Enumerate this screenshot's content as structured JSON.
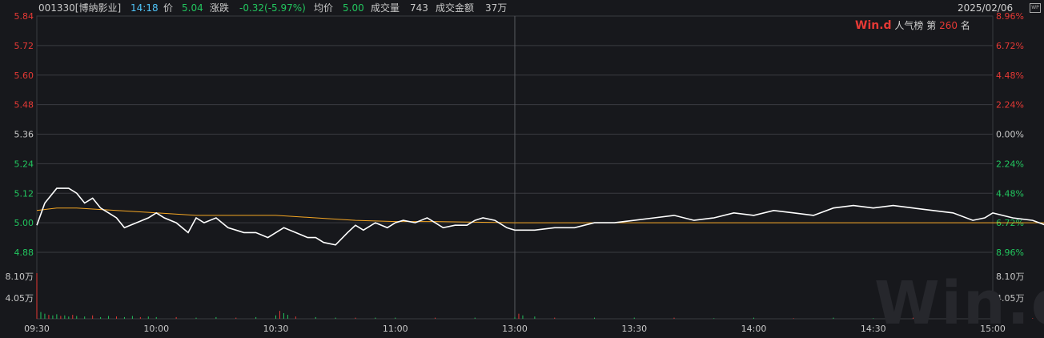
{
  "header": {
    "code": "001330[博纳影业]",
    "time": "14:18",
    "price_label": "价",
    "price": "5.04",
    "change_label": "涨跌",
    "change": "-0.32(-5.97%)",
    "avg_label": "均价",
    "avg": "5.00",
    "volume_label": "成交量",
    "volume": "743",
    "amount_label": "成交金额",
    "amount": "37万",
    "date": "2025/02/06",
    "wp_icon": "wp-icon"
  },
  "badge": {
    "logo": "Win.d",
    "text": "人气榜",
    "rank_prefix": "第",
    "rank": "260",
    "rank_suffix": "名"
  },
  "watermark": "Win.d",
  "colors": {
    "up": "#e53935",
    "down": "#22c55e",
    "price_line": "#ffffff",
    "avg_line": "#f5a623",
    "grid": "#3a3b40"
  },
  "chart_data": {
    "type": "line",
    "x_ticks": [
      "09:30",
      "10:00",
      "10:30",
      "11:00",
      "13:00",
      "13:30",
      "14:00",
      "14:30",
      "15:00"
    ],
    "y_ticks_price": [
      "5.84",
      "5.72",
      "5.60",
      "5.48",
      "5.36",
      "5.24",
      "5.12",
      "5.00",
      "4.88"
    ],
    "y_ticks_pct": [
      "8.96%",
      "6.72%",
      "4.48%",
      "2.24%",
      "0.00%",
      "2.24%",
      "4.48%",
      "6.72%",
      "8.96%"
    ],
    "ylim": [
      4.88,
      5.84
    ],
    "prev_close": 5.36,
    "volume_ticks": [
      "8.10万",
      "4.05万"
    ],
    "volume_max": 8.1,
    "series": [
      {
        "name": "price",
        "x": [
          0,
          2,
          5,
          8,
          10,
          12,
          14,
          16,
          18,
          20,
          22,
          25,
          28,
          30,
          32,
          35,
          38,
          40,
          42,
          45,
          48,
          50,
          52,
          55,
          58,
          60,
          62,
          65,
          68,
          70,
          72,
          75,
          78,
          80,
          82,
          85,
          88,
          90,
          92,
          95,
          98,
          100,
          102,
          105,
          108,
          110,
          112,
          115,
          118,
          120,
          125,
          130,
          135,
          140,
          145,
          150,
          155,
          160,
          165,
          170,
          175,
          180,
          185,
          190,
          195,
          200,
          205,
          210,
          215,
          220,
          225,
          230,
          235,
          238,
          240,
          245,
          250,
          255,
          260,
          265,
          270,
          275,
          280,
          285,
          290,
          295,
          300,
          305,
          310,
          315,
          320,
          325,
          330,
          335,
          340,
          345,
          350,
          355,
          360,
          365,
          370,
          375,
          380,
          385,
          390,
          395,
          400,
          405,
          410,
          415,
          420,
          425,
          430,
          435,
          440,
          445,
          450,
          455,
          460,
          465,
          470,
          475,
          480
        ],
        "y": [
          4.99,
          5.08,
          5.14,
          5.14,
          5.12,
          5.08,
          5.1,
          5.06,
          5.04,
          5.02,
          4.98,
          5.0,
          5.02,
          5.04,
          5.02,
          5.0,
          4.96,
          5.02,
          5.0,
          5.02,
          4.98,
          4.97,
          4.96,
          4.96,
          4.94,
          4.96,
          4.98,
          4.96,
          4.94,
          4.94,
          4.92,
          4.91,
          4.96,
          4.99,
          4.97,
          5.0,
          4.98,
          5.0,
          5.01,
          5.0,
          5.02,
          5.0,
          4.98,
          4.99,
          4.99,
          5.01,
          5.02,
          5.01,
          4.98,
          4.97,
          4.97,
          4.98,
          4.98,
          5.0,
          5.0,
          5.01,
          5.02,
          5.03,
          5.01,
          5.02,
          5.04,
          5.03,
          5.05,
          5.04,
          5.03,
          5.06,
          5.07,
          5.06,
          5.07,
          5.06,
          5.05,
          5.04,
          5.01,
          5.02,
          5.04,
          5.02,
          5.01,
          4.98,
          4.98,
          4.98,
          4.99,
          4.99,
          5.0,
          5.01,
          5.01,
          4.99,
          4.99,
          4.99,
          4.99,
          4.99,
          4.98,
          4.98,
          4.99,
          5.0,
          4.99,
          4.99,
          4.98,
          4.99,
          5.0,
          5.0,
          5.0,
          5.0,
          4.99,
          5.0,
          5.01,
          5.01,
          5.01,
          5.02,
          5.02,
          5.02,
          5.03,
          5.04,
          5.04,
          5.04,
          5.05,
          5.04,
          5.05,
          5.05,
          5.06,
          5.07,
          5.07,
          5.07,
          5.08
        ]
      },
      {
        "name": "avg",
        "x": [
          0,
          5,
          10,
          20,
          30,
          40,
          50,
          60,
          70,
          80,
          90,
          100,
          120,
          150,
          180,
          200,
          240,
          300,
          360,
          420,
          480
        ],
        "y": [
          5.05,
          5.06,
          5.06,
          5.05,
          5.04,
          5.03,
          5.03,
          5.03,
          5.02,
          5.01,
          5.005,
          5.005,
          5.0,
          5.0,
          5.0,
          5.0,
          5.0,
          5.0,
          5.0,
          5.0,
          5.0
        ]
      },
      {
        "name": "volume",
        "x": [
          0,
          1,
          2,
          3,
          4,
          5,
          6,
          7,
          8,
          9,
          10,
          12,
          14,
          16,
          18,
          20,
          22,
          24,
          26,
          28,
          30,
          35,
          40,
          45,
          50,
          55,
          60,
          61,
          62,
          63,
          65,
          70,
          75,
          80,
          85,
          90,
          100,
          110,
          120,
          121,
          122,
          125,
          130,
          140,
          150,
          160,
          170,
          180,
          190,
          200,
          210,
          220,
          230,
          240,
          250,
          260,
          270,
          280,
          290,
          300,
          310,
          320,
          330,
          340,
          350,
          360,
          370,
          380,
          390,
          400,
          410,
          420,
          430,
          440,
          450,
          460,
          470,
          476,
          478,
          480
        ],
        "y": [
          8.1,
          1.2,
          0.9,
          0.7,
          0.6,
          0.8,
          0.5,
          0.6,
          0.4,
          0.7,
          0.5,
          0.4,
          0.6,
          0.3,
          0.5,
          0.4,
          0.3,
          0.5,
          0.3,
          0.4,
          0.3,
          0.3,
          0.2,
          0.3,
          0.2,
          0.3,
          0.6,
          1.4,
          1.0,
          0.7,
          0.4,
          0.3,
          0.2,
          0.2,
          0.2,
          0.2,
          0.2,
          0.2,
          0.3,
          0.9,
          0.6,
          0.4,
          0.2,
          0.2,
          0.2,
          0.2,
          0.1,
          0.2,
          0.1,
          0.2,
          0.1,
          0.2,
          0.1,
          0.2,
          0.1,
          0.2,
          0.1,
          0.2,
          0.1,
          0.2,
          0.1,
          0.2,
          0.1,
          0.2,
          0.1,
          0.2,
          0.1,
          0.2,
          0.1,
          0.2,
          0.1,
          0.2,
          0.1,
          0.2,
          0.2,
          0.3,
          0.3,
          0.6,
          0.5,
          0.4
        ]
      }
    ]
  }
}
